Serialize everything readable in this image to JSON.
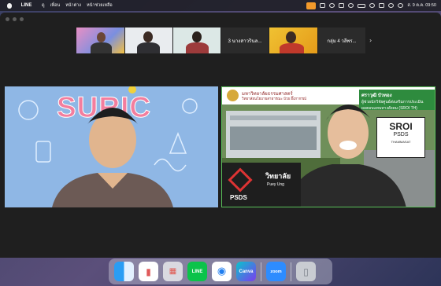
{
  "menubar": {
    "app_name": "LINE",
    "items": [
      "ดู",
      "เพื่อน",
      "หน้าต่าง",
      "หน้าช่วยเหลือ"
    ],
    "clock": "ส. 9 ต.ค. 09:50"
  },
  "meeting": {
    "participant_strip": {
      "named_tile_label": "3 นางสาวรินล...",
      "group_tile_label": "กลุ่ม 4 วลีพร..."
    },
    "left_video": {
      "backdrop_text": "SURIC"
    },
    "right_video": {
      "university_name": "มหาวิทยาลัยธรรมศาสตร์",
      "faculty_name": "วิทยาลัยนโยบายสาธารณะ ป๋วย อึ๊งภากรณ์",
      "ribbon_name": "ศราวุฒิ บัวทอง",
      "ribbon_line1": "ผู้ช่วยนักวิจัยศูนย์ส่งเสริมการประเมิน",
      "ribbon_line2": "ผลตอบแทนทางสังคม (SROI TH)",
      "sroi_title": "SROI",
      "sroi_sub": "PSDS",
      "sroi_caption": "THAMMASAT",
      "psds_logo_text": "PSDS",
      "psds_thai": "วิทยาลัย",
      "psds_en": "Puey Ung"
    }
  },
  "dock": {
    "line_label": "LINE",
    "canva_label": "Canva",
    "zoom_label": "zoom"
  },
  "colors": {
    "active_speaker_border": "#5ac05a",
    "ribbon_green": "#2e8b3e",
    "accent_orange": "#f39a2b"
  }
}
